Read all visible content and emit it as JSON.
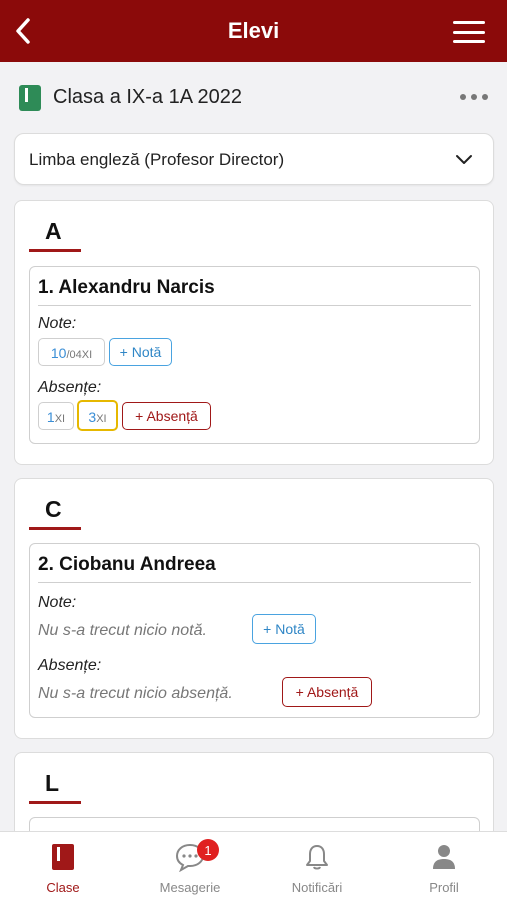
{
  "header": {
    "title": "Elevi"
  },
  "class": {
    "name": "Clasa a IX-a 1A 2022"
  },
  "subject": {
    "selected": "Limba engleză (Profesor Director)"
  },
  "labels": {
    "grades": "Note:",
    "absences": "Absențe:"
  },
  "buttons": {
    "add_grade": "+ Notă",
    "add_absence": "+ Absență"
  },
  "sections": [
    {
      "letter": "A",
      "students": [
        {
          "name": "1. Alexandru Narcis",
          "grades": [
            {
              "value": "10",
              "date": "/04XI"
            }
          ],
          "absences": [
            {
              "value": "1",
              "month": "XI"
            },
            {
              "value": "3",
              "month": "XI"
            }
          ]
        }
      ]
    },
    {
      "letter": "C",
      "students": [
        {
          "name": "2. Ciobanu Andreea",
          "grades_empty": "Nu s-a trecut nicio notă.",
          "absences_empty": "Nu s-a trecut nicio absență."
        }
      ]
    },
    {
      "letter": "L"
    }
  ],
  "nav": {
    "items": [
      {
        "label": "Clase",
        "icon": "book-icon",
        "active": true
      },
      {
        "label": "Mesagerie",
        "icon": "chat-icon",
        "badge": "1"
      },
      {
        "label": "Notificări",
        "icon": "bell-icon"
      },
      {
        "label": "Profil",
        "icon": "person-icon"
      }
    ]
  },
  "colors": {
    "primary": "#8b0a0a",
    "accent_blue": "#3a8ed6",
    "highlight_yellow": "#e6b800"
  }
}
